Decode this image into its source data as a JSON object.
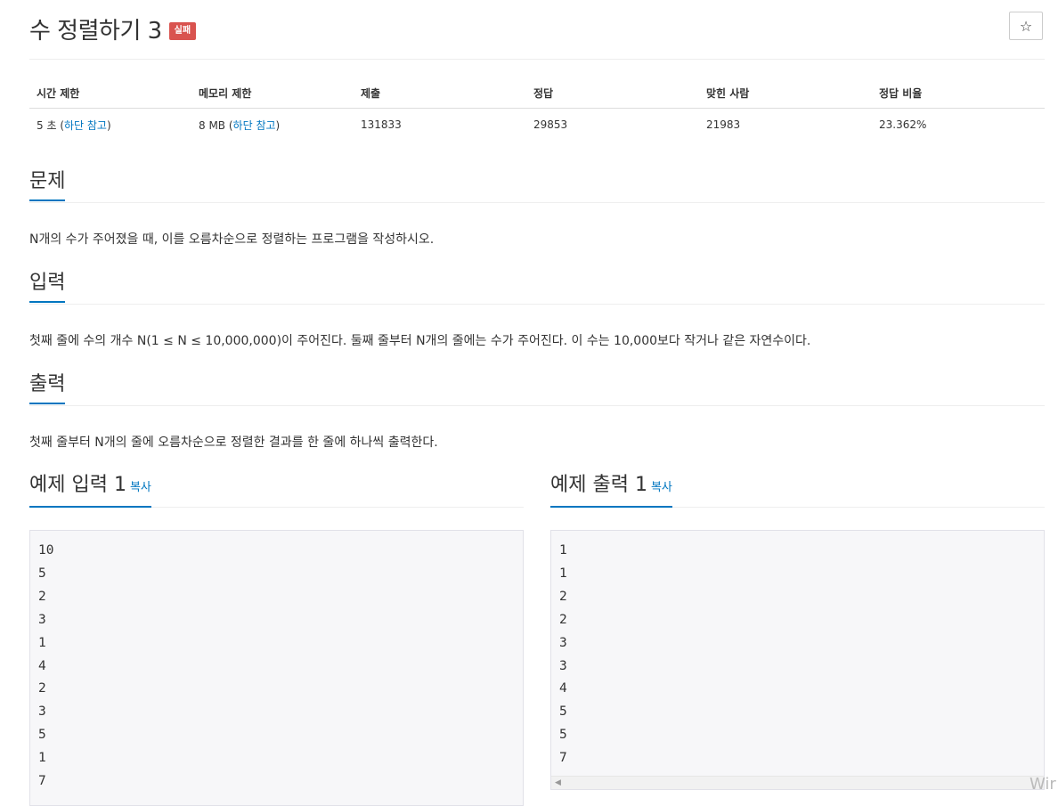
{
  "problem": {
    "title": "수 정렬하기 3",
    "result_label": "실패",
    "star_glyph": "☆"
  },
  "info_table": {
    "headers": [
      "시간 제한",
      "메모리 제한",
      "제출",
      "정답",
      "맞힌 사람",
      "정답 비율"
    ],
    "time_limit": "5 초 ",
    "memory_limit": "8 MB ",
    "note_link": "하단 참고",
    "paren_open": "(",
    "paren_close": ")",
    "submissions": "131833",
    "accepted": "29853",
    "solvers": "21983",
    "ratio": "23.362%"
  },
  "sections": {
    "description": {
      "heading": "문제",
      "text": "N개의 수가 주어졌을 때, 이를 오름차순으로 정렬하는 프로그램을 작성하시오."
    },
    "input": {
      "heading": "입력",
      "text": "첫째 줄에 수의 개수 N(1 ≤ N ≤ 10,000,000)이 주어진다. 둘째 줄부터 N개의 줄에는 수가 주어진다. 이 수는 10,000보다 작거나 같은 자연수이다."
    },
    "output": {
      "heading": "출력",
      "text": "첫째 줄부터 N개의 줄에 오름차순으로 정렬한 결과를 한 줄에 하나씩 출력한다."
    }
  },
  "samples": {
    "input": {
      "heading": "예제 입력 1",
      "copy_label": "복사",
      "content": "10\n5\n2\n3\n1\n4\n2\n3\n5\n1\n7"
    },
    "output": {
      "heading": "예제 출력 1",
      "copy_label": "복사",
      "content": "1\n1\n2\n2\n3\n3\n4\n5\n5\n7"
    }
  },
  "overlay": {
    "watermark_text": "Wir"
  },
  "colors": {
    "accent": "#0076c0",
    "fail_badge": "#d9534f",
    "code_bg": "#f7f7f9"
  }
}
